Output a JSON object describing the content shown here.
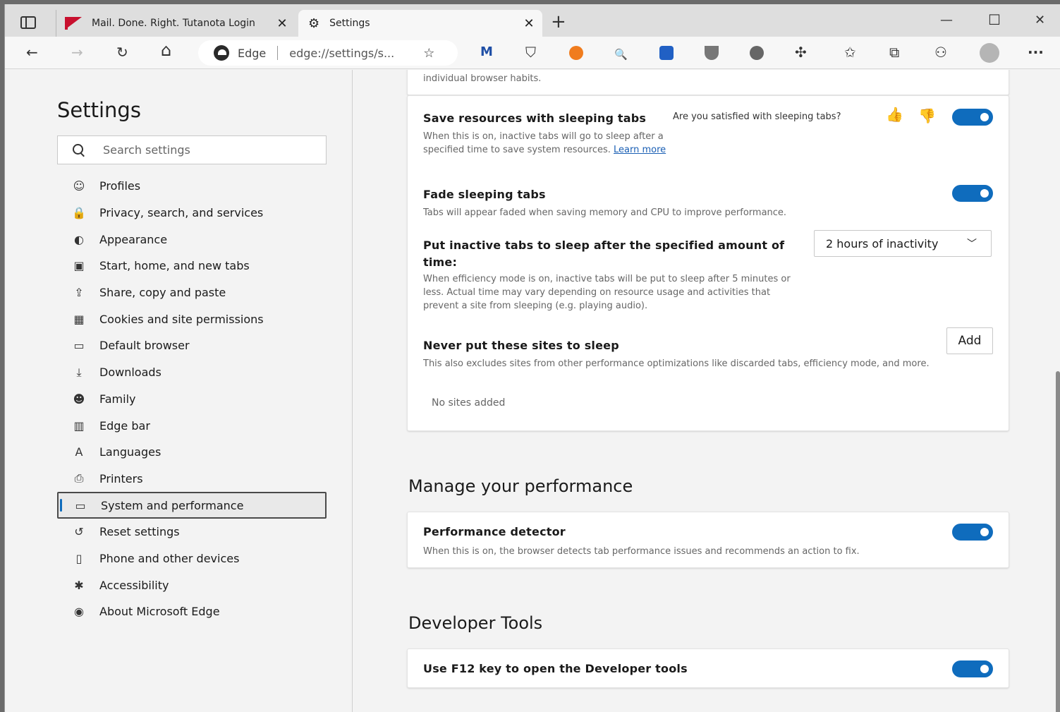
{
  "browser": {
    "tabs": [
      {
        "title": "Mail. Done. Right. Tutanota Login",
        "close": "✕"
      },
      {
        "title": "Settings",
        "close": "✕"
      }
    ],
    "new_tab": "+",
    "window_controls": {
      "minimize": "—",
      "maximize": "☐",
      "close": "✕"
    },
    "address": {
      "site": "Edge",
      "url": "edge://settings/s..."
    },
    "nav_icons": {
      "back": "←",
      "forward": "→",
      "refresh": "↻",
      "home": "⌂",
      "more": "···"
    },
    "colors": {
      "accent": "#0f6cbd",
      "tutanota": "#c8102e"
    }
  },
  "sidebar": {
    "title": "Settings",
    "search_placeholder": "Search settings",
    "items": [
      {
        "label": "Profiles",
        "icon": "☺"
      },
      {
        "label": "Privacy, search, and services",
        "icon": "🔒"
      },
      {
        "label": "Appearance",
        "icon": "◐"
      },
      {
        "label": "Start, home, and new tabs",
        "icon": "▣"
      },
      {
        "label": "Share, copy and paste",
        "icon": "⇪"
      },
      {
        "label": "Cookies and site permissions",
        "icon": "▦"
      },
      {
        "label": "Default browser",
        "icon": "▭"
      },
      {
        "label": "Downloads",
        "icon": "⤓"
      },
      {
        "label": "Family",
        "icon": "☻"
      },
      {
        "label": "Edge bar",
        "icon": "▥"
      },
      {
        "label": "Languages",
        "icon": "A"
      },
      {
        "label": "Printers",
        "icon": "⎙"
      },
      {
        "label": "System and performance",
        "icon": "▭"
      },
      {
        "label": "Reset settings",
        "icon": "↺"
      },
      {
        "label": "Phone and other devices",
        "icon": "▯"
      },
      {
        "label": "Accessibility",
        "icon": "✱"
      },
      {
        "label": "About Microsoft Edge",
        "icon": "◉"
      }
    ]
  },
  "main": {
    "top_fragment": "individual browser habits.",
    "sleeping": {
      "title": "Save resources with sleeping tabs",
      "feedback_q": "Are you satisfied with sleeping tabs?",
      "desc": "When this is on, inactive tabs will go to sleep after a specified time to save system resources.",
      "learn_more": "Learn more"
    },
    "fade": {
      "title": "Fade sleeping tabs",
      "desc": "Tabs will appear faded when saving memory and CPU to improve performance."
    },
    "inactive": {
      "title": "Put inactive tabs to sleep after the specified amount of time:",
      "desc": "When efficiency mode is on, inactive tabs will be put to sleep after 5 minutes or less. Actual time may vary depending on resource usage and activities that prevent a site from sleeping (e.g. playing audio).",
      "selected": "2 hours of inactivity"
    },
    "never": {
      "title": "Never put these sites to sleep",
      "desc": "This also excludes sites from other performance optimizations like discarded tabs, efficiency mode, and more.",
      "add": "Add",
      "empty": "No sites added"
    },
    "perf_header": "Manage your performance",
    "detector": {
      "title": "Performance detector",
      "desc": "When this is on, the browser detects tab performance issues and recommends an action to fix."
    },
    "dev_header": "Developer Tools",
    "f12": {
      "title": "Use F12 key to open the Developer tools"
    }
  }
}
